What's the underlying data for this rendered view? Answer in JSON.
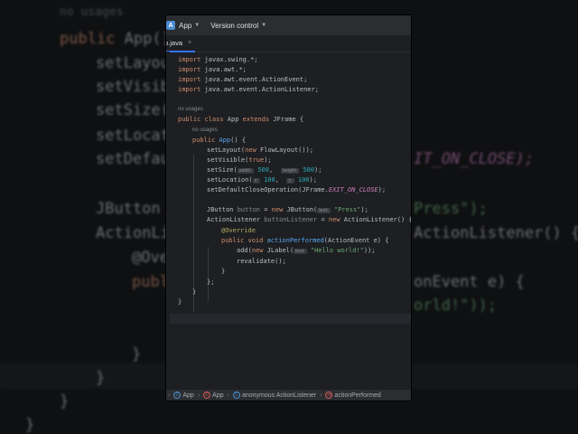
{
  "backdrop": {
    "lines": [
      {
        "text": "no usages",
        "cls": "bg-dim"
      },
      {
        "text": "public App()",
        "cls": "bg-kw"
      },
      {
        "text": "setLayout",
        "cls": "bg-fn"
      },
      {
        "text": "setVisible",
        "cls": "bg-fn"
      },
      {
        "text": "setSize(",
        "cls": "bg-fn"
      },
      {
        "text": "setLocation",
        "cls": "bg-fn"
      },
      {
        "text": "setDefau",
        "cls": "bg-fn"
      },
      {
        "text": "JButton",
        "cls": "bg-fn"
      },
      {
        "text": "ActionLi",
        "cls": "bg-fn"
      },
      {
        "text": "@Ove",
        "cls": "bg-fn"
      },
      {
        "text": "publ",
        "cls": "bg-kw"
      },
      {
        "text": "}",
        "cls": "bg-fn"
      },
      {
        "text": "}",
        "cls": "bg-fn"
      },
      {
        "text": "}",
        "cls": "bg-fn"
      },
      {
        "text": "}",
        "cls": "bg-fn"
      }
    ],
    "right": [
      {
        "text": "IT_ON_CLOSE);",
        "cls": "bg-fld"
      },
      {
        "text": "Press\");",
        "cls": "bg-str"
      },
      {
        "text": "ActionListener() {",
        "cls": "bg-fn"
      },
      {
        "text": "onEvent e) {",
        "cls": "bg-fn"
      },
      {
        "text": "orld!\"));",
        "cls": "bg-str"
      }
    ]
  },
  "topbar": {
    "project_badge": "A",
    "project": "App",
    "vcs": "Version control"
  },
  "tab": {
    "label": "p.java",
    "close": "×"
  },
  "code": {
    "l1": [
      "import",
      " javax.swing.*;"
    ],
    "l2": [
      "import",
      " java.awt.*;"
    ],
    "l3": [
      "import",
      " java.awt.event.ActionEvent;"
    ],
    "l4": [
      "import",
      " java.awt.event.ActionListener;"
    ],
    "hint1": "no usages",
    "l5a": "public class ",
    "l5b": "App ",
    "l5c": "extends ",
    "l5d": "JFrame {",
    "hint2": "no usages",
    "l6a": "public ",
    "l6b": "App",
    "l6c": "() {",
    "l7a": "setLayout(",
    "l7b": "new ",
    "l7c": "FlowLayout());",
    "l8a": "setVisible(",
    "l8b": "true",
    "l8c": ");",
    "l9a": "setSize(",
    "l9h1": "width:",
    "l9b": " 500",
    "l9c": ",  ",
    "l9h2": "height:",
    "l9d": " 500",
    "l9e": ");",
    "l10a": "setLocation(",
    "l10h1": "x:",
    "l10b": " 100",
    "l10c": ",  ",
    "l10h2": "y:",
    "l10d": " 100",
    "l10e": ");",
    "l11a": "setDefaultCloseOperation(JFrame.",
    "l11b": "EXIT_ON_CLOSE",
    "l11c": ");",
    "l12a": "JButton ",
    "l12b": "button",
    "l12c": " = ",
    "l12d": "new ",
    "l12e": "JButton(",
    "l12h": "text:",
    "l12f": " \"Press\"",
    "l12g": ");",
    "l13a": "ActionListener ",
    "l13b": "buttonListener",
    "l13c": " = ",
    "l13d": "new ",
    "l13e": "ActionListener() {",
    "l14": "@Override",
    "l15a": "public void ",
    "l15b": "actionPerformed",
    "l15c": "(ActionEvent e) {",
    "l16a": "add(",
    "l16b": "new ",
    "l16c": "JLabel(",
    "l16h": "text:",
    "l16d": " \"Hello world!\"",
    "l16e": "));",
    "l17": "revalidate();",
    "l18": "}",
    "l19": "};",
    "l20": "}",
    "l21": "}"
  },
  "status": {
    "crumbs": [
      {
        "icon": "C",
        "label": "App"
      },
      {
        "icon": "C",
        "label": "App"
      },
      {
        "icon": "C",
        "label": "anonymous ActionListener"
      },
      {
        "icon": "m",
        "label": "actionPerformed"
      }
    ],
    "sep": "›"
  }
}
